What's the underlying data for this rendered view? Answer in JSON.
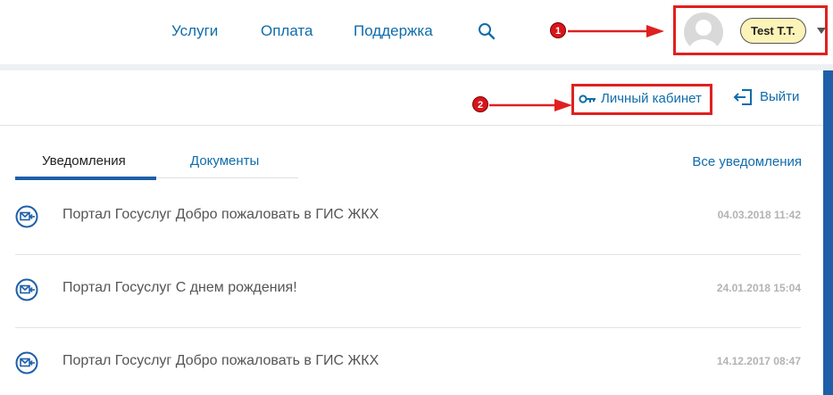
{
  "header": {
    "nav": [
      {
        "label": "Услуги"
      },
      {
        "label": "Оплата"
      },
      {
        "label": "Поддержка"
      }
    ],
    "user": {
      "name": "Test T.T."
    }
  },
  "annotations": {
    "marker_1": "1",
    "marker_2": "2",
    "arrow_color": "#e02020"
  },
  "account": {
    "cabinet_label": "Личный кабинет",
    "logout_label": "Выйти"
  },
  "tabs": [
    {
      "label": "Уведомления",
      "active": true
    },
    {
      "label": "Документы",
      "active": false
    }
  ],
  "all_notifications_label": "Все уведомления",
  "notifications": [
    {
      "text": "Портал Госуслуг Добро пожаловать в ГИС ЖКХ",
      "date": "04.03.2018 11:42"
    },
    {
      "text": "Портал Госуслуг С днем рождения!",
      "date": "24.01.2018 15:04"
    },
    {
      "text": "Портал Госуслуг Добро пожаловать в ГИС ЖКХ",
      "date": "14.12.2017 08:47"
    }
  ],
  "colors": {
    "link": "#0f6cab",
    "accent": "#1e5fa8",
    "highlight": "#e02020",
    "user_pill": "#fcf3b8"
  },
  "icons": {
    "search": "search-icon",
    "key": "key-icon",
    "logout": "logout-icon",
    "mail": "mail-icon"
  }
}
